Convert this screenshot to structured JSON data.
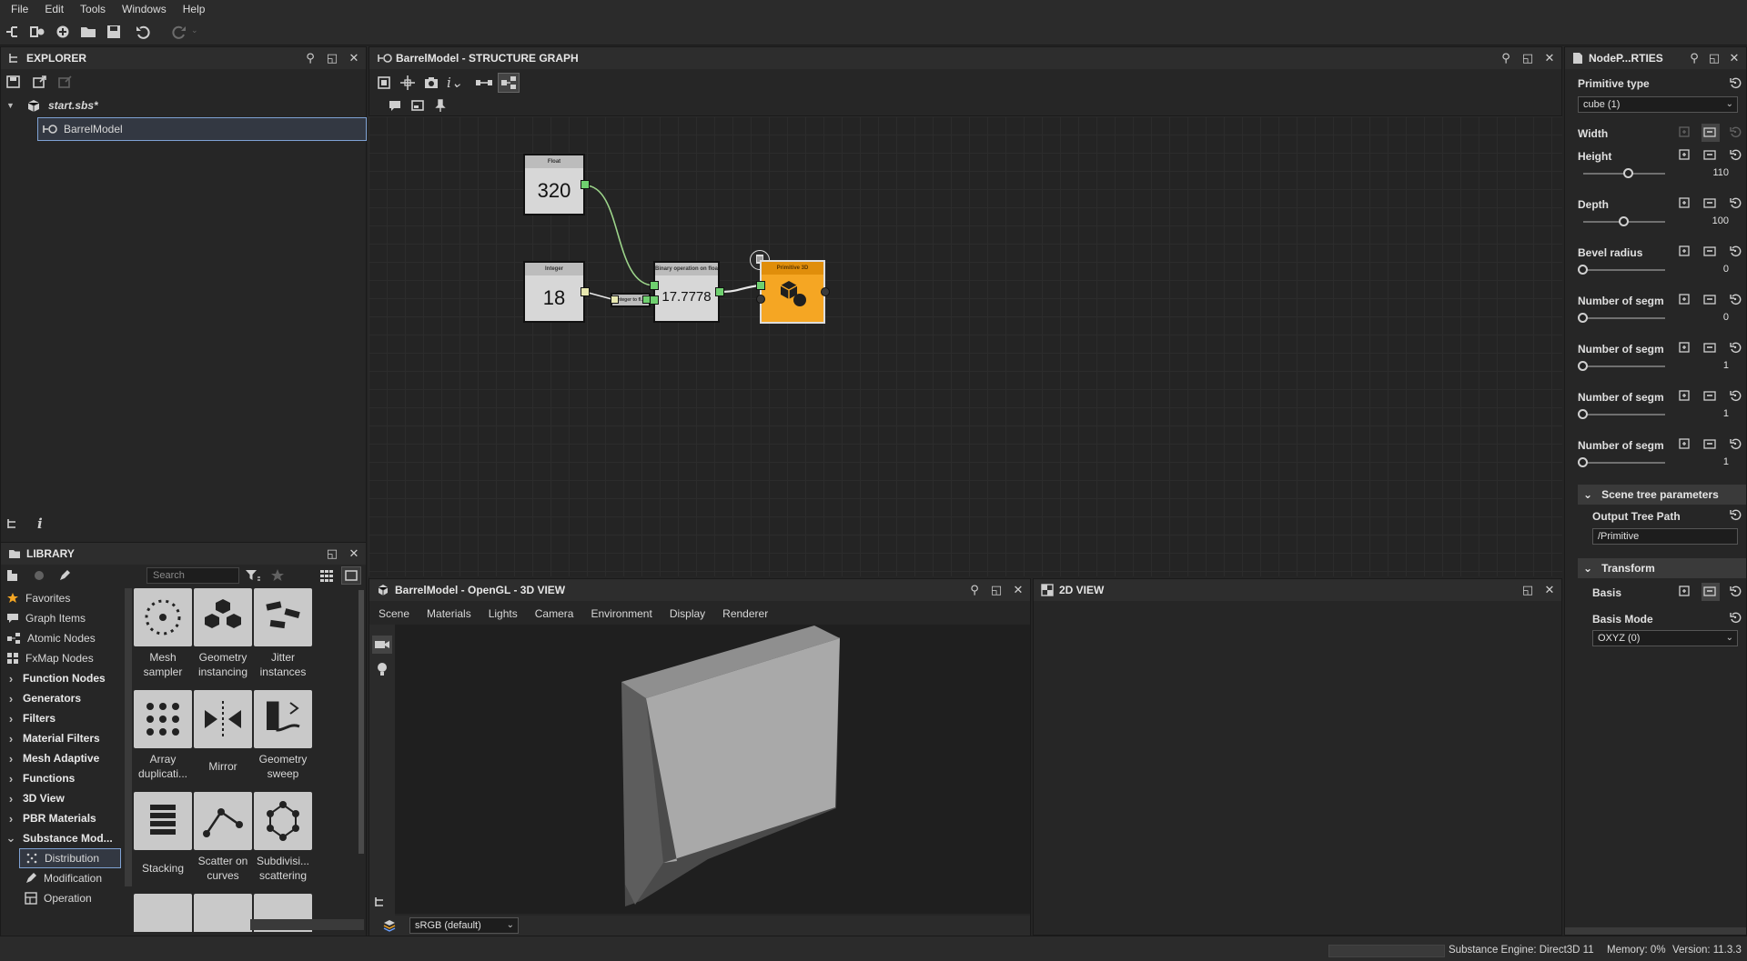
{
  "menu": [
    "File",
    "Edit",
    "Tools",
    "Windows",
    "Help"
  ],
  "explorer": {
    "title": "EXPLORER",
    "file": "start.sbs*",
    "graph": "BarrelModel"
  },
  "library": {
    "title": "LIBRARY",
    "search_placeholder": "Search",
    "categories": [
      {
        "label": "Favorites",
        "icon": "star-icon",
        "bold": false,
        "arrow": false
      },
      {
        "label": "Graph Items",
        "icon": "comment-icon",
        "bold": false,
        "arrow": false
      },
      {
        "label": "Atomic Nodes",
        "icon": "atomic-nodes-icon",
        "bold": false,
        "arrow": false
      },
      {
        "label": "FxMap Nodes",
        "icon": "fxmap-icon",
        "bold": false,
        "arrow": false
      },
      {
        "label": "Function Nodes",
        "bold": true,
        "arrow": "right"
      },
      {
        "label": "Generators",
        "bold": true,
        "arrow": "right"
      },
      {
        "label": "Filters",
        "bold": true,
        "arrow": "right"
      },
      {
        "label": "Material Filters",
        "bold": true,
        "arrow": "right"
      },
      {
        "label": "Mesh Adaptive",
        "bold": true,
        "arrow": "right"
      },
      {
        "label": "Functions",
        "bold": true,
        "arrow": "right"
      },
      {
        "label": "3D View",
        "bold": true,
        "arrow": "right"
      },
      {
        "label": "PBR Materials",
        "bold": true,
        "arrow": "right"
      },
      {
        "label": "Substance Mod...",
        "bold": true,
        "arrow": "down"
      },
      {
        "label": "Distribution",
        "icon": "distribution-icon",
        "bold": false,
        "arrow": false,
        "selected": true
      },
      {
        "label": "Modification",
        "icon": "modification-icon",
        "bold": false,
        "arrow": false
      },
      {
        "label": "Operation",
        "icon": "operation-icon",
        "bold": false,
        "arrow": false
      }
    ],
    "tiles": [
      {
        "label": "Mesh sampler",
        "icon": "mesh-sampler-icon"
      },
      {
        "label": "Geometry instancing",
        "icon": "geometry-instancing-icon"
      },
      {
        "label": "Jitter instances",
        "icon": "jitter-instances-icon"
      },
      {
        "label": "Array duplicati...",
        "icon": "array-duplication-icon"
      },
      {
        "label": "Mirror",
        "icon": "mirror-icon"
      },
      {
        "label": "Geometry sweep",
        "icon": "geometry-sweep-icon"
      },
      {
        "label": "Stacking",
        "icon": "stacking-icon"
      },
      {
        "label": "Scatter on curves",
        "icon": "scatter-on-curves-icon"
      },
      {
        "label": "Subdivisi... scattering",
        "icon": "subdivision-scattering-icon"
      }
    ]
  },
  "graph": {
    "title": "BarrelModel - STRUCTURE GRAPH",
    "nodes": {
      "float": {
        "header": "Float",
        "value": "320"
      },
      "integer": {
        "header": "Integer",
        "value": "18"
      },
      "convert": {
        "header": "Integer to fl..."
      },
      "binary": {
        "header": "Binary operation on float",
        "value": "17.7778"
      },
      "primitive": {
        "header": "Primitive 3D"
      }
    }
  },
  "view3d": {
    "title": "BarrelModel - OpenGL - 3D VIEW",
    "menu": [
      "Scene",
      "Materials",
      "Lights",
      "Camera",
      "Environment",
      "Display",
      "Renderer"
    ],
    "colorspace": "sRGB (default)"
  },
  "view2d": {
    "title": "2D VIEW"
  },
  "properties": {
    "title": "NodeP...RTIES",
    "primitive_type_label": "Primitive type",
    "primitive_type_value": "cube (1)",
    "width_label": "Width",
    "params": [
      {
        "label": "Height",
        "value": "110",
        "pos": 0.55
      },
      {
        "label": "Depth",
        "value": "100",
        "pos": 0.5
      },
      {
        "label": "Bevel radius",
        "value": "0",
        "pos": 0
      },
      {
        "label": "Number of segm",
        "value": "0",
        "pos": 0
      },
      {
        "label": "Number of segm",
        "value": "1",
        "pos": 0
      },
      {
        "label": "Number of segm",
        "value": "1",
        "pos": 0
      },
      {
        "label": "Number of segm",
        "value": "1",
        "pos": 0
      }
    ],
    "scene_tree_section": "Scene tree parameters",
    "output_tree_path_label": "Output Tree Path",
    "output_tree_path_value": "/Primitive",
    "transform_section": "Transform",
    "basis_label": "Basis",
    "basis_mode_label": "Basis Mode",
    "basis_mode_value": "OXYZ (0)"
  },
  "status": {
    "engine": "Substance Engine: Direct3D 11",
    "memory": "Memory: 0%",
    "version": "Version: 11.3.3"
  }
}
